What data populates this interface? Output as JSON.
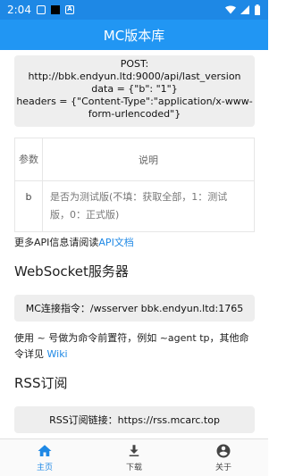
{
  "status_bar": {
    "time": "2:04",
    "icons": [
      "image-icon",
      "black-square-icon",
      "a-icon",
      "wifi-icon",
      "signal-icon",
      "battery-icon"
    ]
  },
  "app_bar": {
    "title": "MC版本库"
  },
  "api": {
    "request_lines": [
      "POST:",
      "http://bbk.endyun.ltd:9000/api/last_version",
      "data = {\"b\": \"1\"}",
      "headers = {\"Content-Type\":\"application/x-www-form-urlencoded\"}"
    ],
    "table": {
      "header_param": "参数",
      "header_desc": "说明",
      "rows": [
        {
          "param": "b",
          "desc": "是否为测试版(不填：获取全部，1：测试版，0：正式版)"
        }
      ]
    },
    "more_prefix": "更多API信息请阅读",
    "more_link": "API文档"
  },
  "websocket": {
    "heading": "WebSocket服务器",
    "command": "MC连接指令：/wsserver bbk.endyun.ltd:1765",
    "usage_text": "使用 ~ 号做为命令前置符，例如 ~agent tp，其他命令详见 ",
    "usage_link": "Wiki"
  },
  "rss": {
    "heading": "RSS订阅",
    "link_text": "RSS订阅链接：https://rss.mcarc.top"
  },
  "bottom_nav": {
    "items": [
      {
        "label": "主页",
        "icon": "home-icon",
        "active": true
      },
      {
        "label": "下载",
        "icon": "download-icon",
        "active": false
      },
      {
        "label": "关于",
        "icon": "account-circle-icon",
        "active": false
      }
    ]
  },
  "colors": {
    "primary": "#2196f3",
    "status_bar": "#1e88e5",
    "link": "#1e88e5",
    "code_bg": "#eeeeee"
  }
}
